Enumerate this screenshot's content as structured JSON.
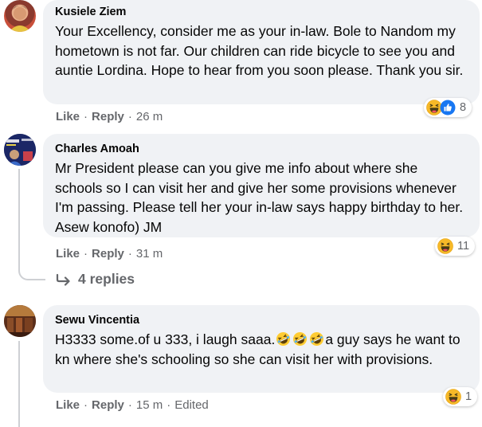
{
  "comments": [
    {
      "author": "Kusiele Ziem",
      "text": "Your Excellency, consider me as your in-law. Bole to Nandom my hometown is not far. Our children can ride bicycle to see you and auntie Lordina. Hope to hear from you soon please. Thank you sir.",
      "like_label": "Like",
      "reply_label": "Reply",
      "time": "26 m",
      "reaction_icons": [
        "haha-icon",
        "like-icon"
      ],
      "reaction_count": "8"
    },
    {
      "author": "Charles Amoah",
      "text": "Mr President please can you give me info about where she schools so I can visit her and give her some provisions whenever I'm passing. Please tell her your in-law says happy birthday to her. Asew konofo) JM",
      "like_label": "Like",
      "reply_label": "Reply",
      "time": "31 m",
      "reaction_icons": [
        "haha-icon"
      ],
      "reaction_count": "11",
      "replies_label": "4 replies"
    },
    {
      "author": "Sewu Vincentia",
      "text_before": "H3333 some.of u 333, i laugh saaa.",
      "text_after": "a guy says he want to kn where she's schooling so she can visit her with provisions.",
      "inline_emoji": "rofl-emoji",
      "inline_emoji_count": 3,
      "like_label": "Like",
      "reply_label": "Reply",
      "time": "15 m",
      "edited_label": "Edited",
      "reaction_icons": [
        "haha-icon"
      ],
      "reaction_count": "1"
    }
  ],
  "colors": {
    "bubble": "#f0f2f5",
    "meta_text": "#65676b",
    "like_blue": "#1877f2",
    "haha_yellow": "#f7b125"
  }
}
